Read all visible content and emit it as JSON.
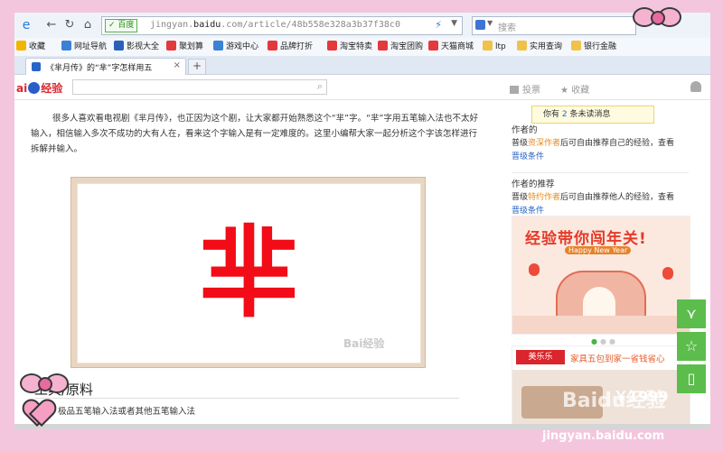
{
  "browser": {
    "url_prefix": "jingyan.",
    "url_domain": "baidu",
    "url_rest": ".com/article/48b558e328a3b37f38c0",
    "secure_label": "百度",
    "search_placeholder": "搜索"
  },
  "bookmarks": [
    {
      "label": "收藏",
      "color": "#f1b500"
    },
    {
      "label": "网址导航",
      "color": "#3a82d6"
    },
    {
      "label": "影视大全",
      "color": "#2a60b8"
    },
    {
      "label": "聚划算",
      "color": "#e4393c"
    },
    {
      "label": "游戏中心",
      "color": "#3a82d6"
    },
    {
      "label": "品牌打折",
      "color": "#e4393c"
    },
    {
      "label": "淘宝特卖",
      "color": "#e4393c"
    },
    {
      "label": "淘宝团购",
      "color": "#e4393c"
    },
    {
      "label": "天猫商城",
      "color": "#e4393c"
    },
    {
      "label": "ltp",
      "color": "#f0c24a"
    },
    {
      "label": "实用查询",
      "color": "#f0c24a"
    },
    {
      "label": "银行金融",
      "color": "#f0c24a"
    }
  ],
  "tab": {
    "title": "《芈月传》的“芈”字怎样用五",
    "close": "×",
    "new": "+"
  },
  "site": {
    "logo_a": "ai",
    "logo_b": "经验",
    "vote": "投票",
    "collect": "收藏"
  },
  "article": {
    "paragraph": "很多人喜欢看电视剧《芈月传》，也正因为这个剧，让大家都开始熟悉这个“芈”字。“芈”字用五笔输入法也不太好输入，相信输入多次不成功的大有人在，看来这个字输入是有一定难度的。这里小编帮大家一起分析这个字该怎样进行拆解并输入。",
    "image_char": "芈",
    "image_watermark": "Bai经验",
    "section_title": "工具/原料",
    "section_item": "极品五笔输入法或者其他五笔输入法"
  },
  "sidebar": {
    "tooltip_prefix": "你有",
    "tooltip_count": "2",
    "tooltip_suffix": "条未读消息",
    "block1_title": "作者的",
    "block1_line_a": "普级",
    "block1_hl": "资深作者",
    "block1_line_b": "后可自由推荐自己的经验，查看",
    "block1_link": "晋级条件",
    "block2_title": "作者的推荐",
    "block2_line_a": "晋级",
    "block2_hl": "特约作者",
    "block2_line_b": "后可自由推荐他人的经验，查看",
    "block2_link": "晋级条件",
    "banner_title": "经验带你闯年关!",
    "banner_sub": "Happy New Year",
    "ad_brand": "美乐乐",
    "ad_text": "家具五包到家一省钱省心",
    "ad_price": "￥1999"
  },
  "watermarks": {
    "bottom": "jingyan.baidu.com",
    "overlay": "Baidu经验"
  },
  "colors": {
    "accent_green": "#5cbd4d",
    "char_red": "#f20c17",
    "page_pink": "#f3c6de"
  }
}
